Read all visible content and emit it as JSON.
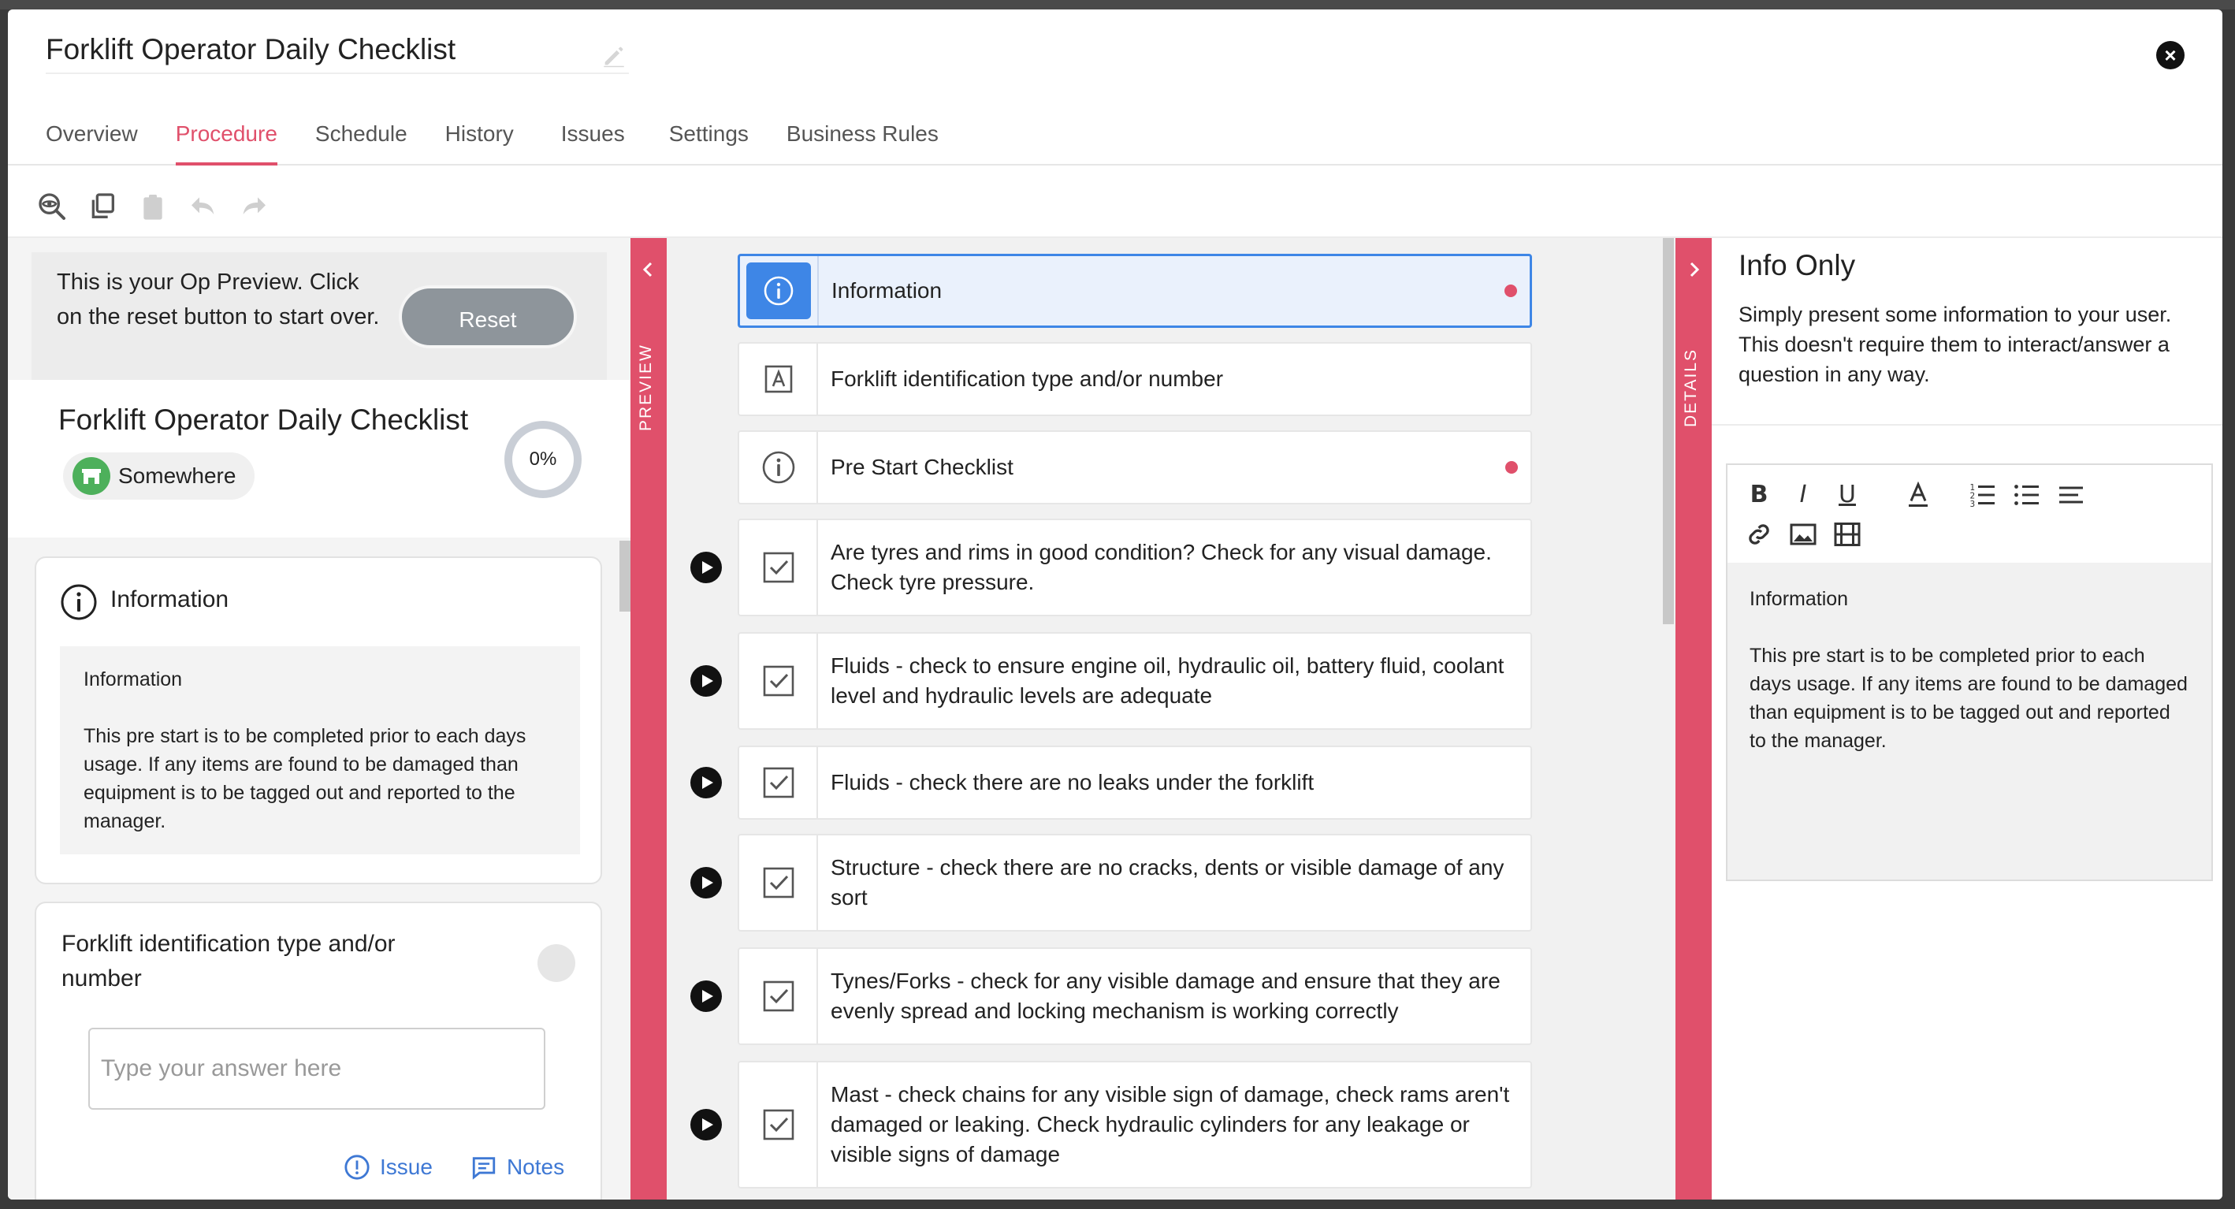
{
  "window": {
    "title": "Forklift Operator Daily Checklist"
  },
  "tabs": [
    "Overview",
    "Procedure",
    "Schedule",
    "History",
    "Issues",
    "Settings",
    "Business Rules"
  ],
  "active_tab": "Procedure",
  "preview": {
    "message": "This is your Op Preview. Click on the reset button to start over.",
    "reset_label": "Reset",
    "op_title": "Forklift Operator Daily Checklist",
    "location": "Somewhere",
    "progress": "0%",
    "info_card": {
      "title": "Information",
      "heading": "Information",
      "body": "This pre start is to be completed prior to each days usage. If any items are found to be damaged than equipment is to be tagged out and reported to the manager."
    },
    "question_card": {
      "title": "Forklift identification type and/or number",
      "placeholder": "Type your answer here",
      "issue_label": "Issue",
      "notes_label": "Notes"
    }
  },
  "side_labels": {
    "preview": "PREVIEW",
    "details": "DETAILS"
  },
  "steps": [
    {
      "text": "Information",
      "icon": "info-icon",
      "dot": true
    },
    {
      "text": "Forklift identification type and/or number",
      "icon": "text-answer-icon",
      "dot": false
    },
    {
      "text": "Pre Start Checklist",
      "icon": "info-icon",
      "dot": true
    },
    {
      "text": "Are tyres and rims in good condition? Check for any visual damage. Check tyre pressure.",
      "icon": "checkbox-icon",
      "dot": false
    },
    {
      "text": "Fluids - check to ensure engine oil, hydraulic oil, battery fluid, coolant level and hydraulic levels are adequate",
      "icon": "checkbox-icon",
      "dot": false
    },
    {
      "text": "Fluids - check there are no leaks under the forklift",
      "icon": "checkbox-icon",
      "dot": false
    },
    {
      "text": "Structure - check there are no cracks, dents or visible damage of any sort",
      "icon": "checkbox-icon",
      "dot": false
    },
    {
      "text": "Tynes/Forks - check for any visible damage and ensure that they are evenly spread and locking mechanism is working correctly",
      "icon": "checkbox-icon",
      "dot": false
    },
    {
      "text": "Mast - check chains for any visible sign of damage, check rams aren't damaged or leaking. Check hydraulic cylinders for any leakage or visible signs of damage",
      "icon": "checkbox-icon",
      "dot": false
    }
  ],
  "details": {
    "title": "Info Only",
    "description": "Simply present some information to your user. This doesn't require them to interact/answer a question in any way.",
    "editor_heading": "Information",
    "editor_body": "This pre start is to be completed prior to each days usage. If any items are found to be damaged than equipment is to be tagged out and reported to the manager."
  },
  "colors": {
    "accent": "#e0506b",
    "selected": "#3e86e6",
    "link": "#3e78d4",
    "location": "#4db05b"
  }
}
